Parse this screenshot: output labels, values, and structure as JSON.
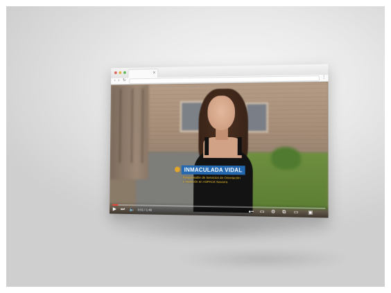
{
  "browser": {
    "tab_close": "×",
    "back_glyph": "‹",
    "forward_glyph": "›",
    "reload_glyph": "↻",
    "menu_glyph": "⋮"
  },
  "video": {
    "lower_third": {
      "name": "INMACULADA VIDAL",
      "role_line1": "Responsable de Servicios de Orientación",
      "role_line2": "e Inserción en ASPACE Navarra"
    },
    "player": {
      "progress_fraction": 0.03,
      "time": "0:01 / 1:45",
      "icons": {
        "play": "▶",
        "next": "⏭",
        "volume": "🔈",
        "autoplay": "●━",
        "subtitles": "▭",
        "settings": "⚙",
        "miniplayer": "⧉",
        "theater": "▭",
        "cast": "▣"
      }
    }
  }
}
